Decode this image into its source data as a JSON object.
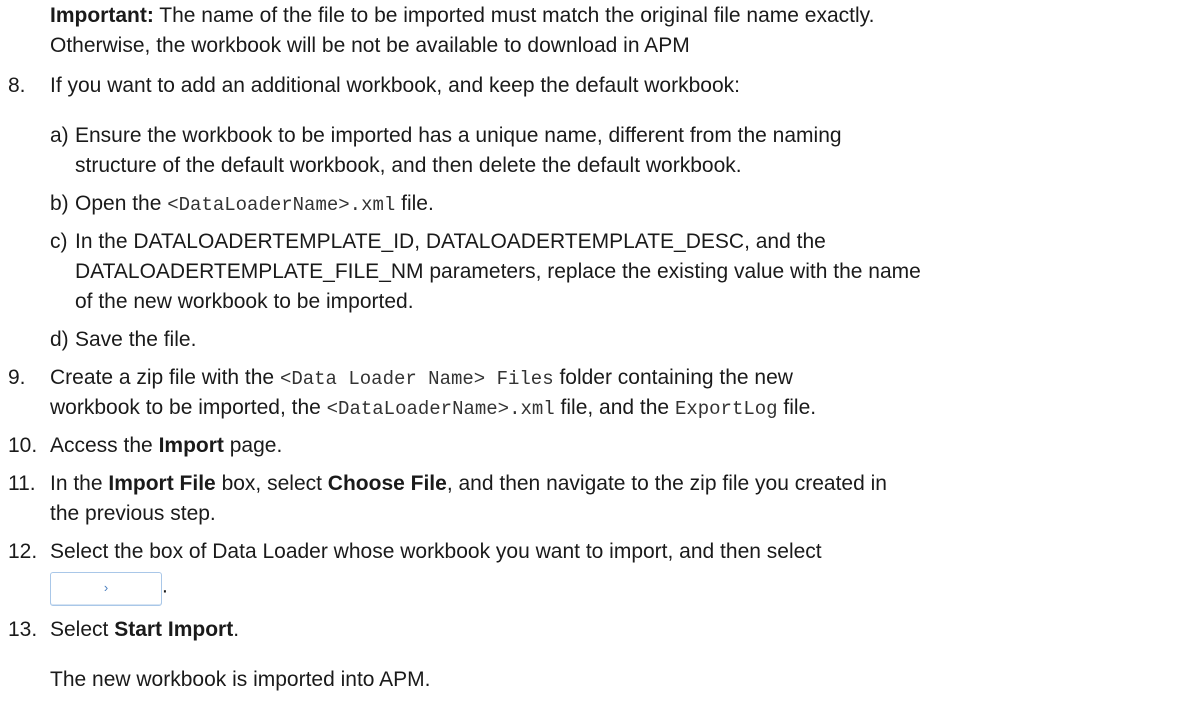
{
  "important": {
    "label": "Important:",
    "text1": " The name of the file to be imported must match the original file name exactly.",
    "text2": "Otherwise, the workbook will be not be available to download in APM"
  },
  "step8": {
    "num": "8.",
    "text": "If you want to add an additional workbook, and keep the default workbook:",
    "subs": [
      {
        "letter": "a)",
        "line1": "Ensure the workbook to be imported has a unique name, different from the naming",
        "line2": "structure of the default workbook, and then delete the default workbook."
      },
      {
        "letter": "b)",
        "pre": "Open the ",
        "code": "<DataLoaderName>.xml",
        "post": " file."
      },
      {
        "letter": "c)",
        "line1": "In the DATALOADERTEMPLATE_ID, DATALOADERTEMPLATE_DESC, and the",
        "line2": "DATALOADERTEMPLATE_FILE_NM parameters, replace the existing value with the name",
        "line3": "of the new workbook to be imported."
      },
      {
        "letter": "d)",
        "text": "Save the file."
      }
    ]
  },
  "step9": {
    "num": "9.",
    "pre": "Create a zip file with the ",
    "code1": "<Data Loader Name> Files",
    "mid1": " folder containing the new",
    "line2_pre": "workbook to be imported, the ",
    "code2": "<DataLoaderName>.xml",
    "mid2": " file, and the ",
    "code3": "ExportLog",
    "post": " file."
  },
  "step10": {
    "num": "10.",
    "pre": "Access the ",
    "bold": "Import",
    "post": " page."
  },
  "step11": {
    "num": "11.",
    "pre": "In the ",
    "bold1": "Import File",
    "mid": " box, select ",
    "bold2": "Choose File",
    "post": ", and then navigate to the zip file you created in",
    "line2": "the previous step."
  },
  "step12": {
    "num": "12.",
    "text": "Select the box of Data Loader whose workbook you want to import, and then select",
    "button_glyph": "›",
    "period": "."
  },
  "step13": {
    "num": "13.",
    "pre": "Select ",
    "bold": "Start Import",
    "post": "."
  },
  "result": {
    "text": "The new workbook is imported into APM."
  }
}
